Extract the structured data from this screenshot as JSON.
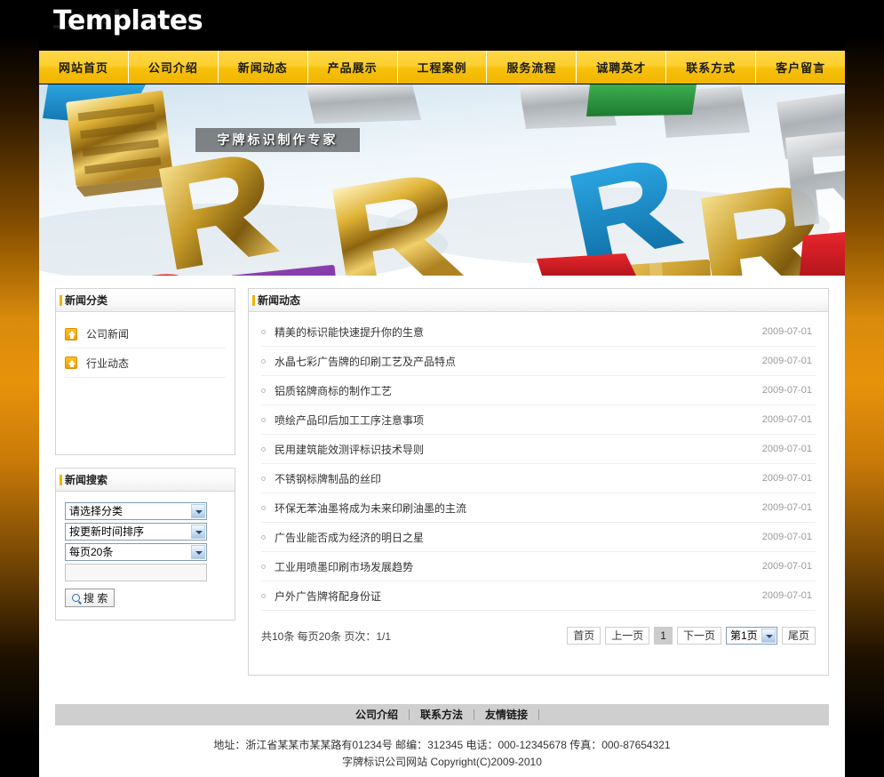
{
  "site": {
    "logo": "Templates"
  },
  "nav": {
    "items": [
      {
        "label": "网站首页"
      },
      {
        "label": "公司介绍"
      },
      {
        "label": "新闻动态"
      },
      {
        "label": "产品展示"
      },
      {
        "label": "工程案例"
      },
      {
        "label": "服务流程"
      },
      {
        "label": "诚聘英才"
      },
      {
        "label": "联系方式"
      },
      {
        "label": "客户留言"
      }
    ]
  },
  "banner": {
    "caption": "字牌标识制作专家"
  },
  "sidebar": {
    "category_panel": {
      "title": "新闻分类",
      "items": [
        {
          "label": "公司新闻"
        },
        {
          "label": "行业动态"
        }
      ]
    },
    "search_panel": {
      "title": "新闻搜索",
      "select_category": "请选择分类",
      "select_order": "按更新时间排序",
      "select_perpage": "每页20条",
      "keyword_value": "",
      "keyword_placeholder": "",
      "search_button": "搜 索"
    }
  },
  "news": {
    "title": "新闻动态",
    "items": [
      {
        "title": "精美的标识能快速提升你的生意",
        "date": "2009-07-01"
      },
      {
        "title": "水晶七彩广告牌的印刷工艺及产品特点",
        "date": "2009-07-01"
      },
      {
        "title": "铝质铭牌商标的制作工艺",
        "date": "2009-07-01"
      },
      {
        "title": "喷绘产品印后加工工序注意事项",
        "date": "2009-07-01"
      },
      {
        "title": "民用建筑能效测评标识技术导则",
        "date": "2009-07-01"
      },
      {
        "title": "不锈钢标牌制品的丝印",
        "date": "2009-07-01"
      },
      {
        "title": "环保无苯油墨将成为未来印刷油墨的主流",
        "date": "2009-07-01"
      },
      {
        "title": "广告业能否成为经济的明日之星",
        "date": "2009-07-01"
      },
      {
        "title": "工业用喷墨印刷市场发展趋势",
        "date": "2009-07-01"
      },
      {
        "title": "户外广告牌将配身份证",
        "date": "2009-07-01"
      }
    ],
    "pager": {
      "status": "共10条 每页20条 页次：1/1",
      "first": "首页",
      "prev": "上一页",
      "current": "1",
      "next": "下一页",
      "jump": "第1页",
      "last": "尾页"
    }
  },
  "footer": {
    "links": [
      {
        "label": "公司介绍"
      },
      {
        "label": "联系方法"
      },
      {
        "label": "友情链接"
      }
    ],
    "address_line": "地址：浙江省某某市某某路有01234号  邮编：312345 电话：000-12345678 传真：000-87654321",
    "copyright_line": "字牌标识公司网站  Copyright(C)2009-2010"
  },
  "colors": {
    "nav_yellow": "#f7c10a",
    "accent_gold": "#f0b400",
    "page_edge_orange": "#e8920c",
    "footer_gray": "#cfcfcf"
  }
}
